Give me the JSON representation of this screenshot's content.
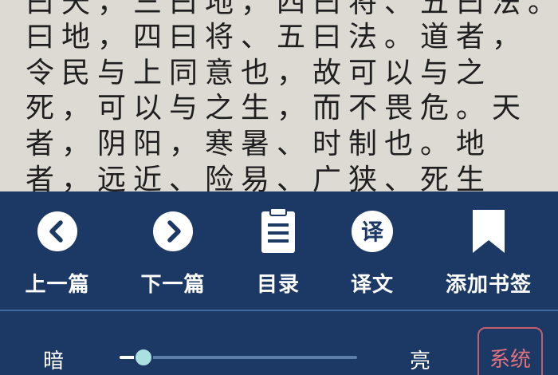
{
  "reader": {
    "lines": [
      "曰天，三曰地，四曰将、五曰法。",
      "曰地，四曰将、五曰法。道者，",
      "令民与上同意也，故可以与之",
      "死，可以与之生，而不畏危。天",
      "者，阴阳，寒暑、时制也。地",
      "者，远近、险易、广狭、死生"
    ]
  },
  "toolbar": {
    "items": [
      {
        "label": "上一篇",
        "icon": "chevron-left-circle-icon"
      },
      {
        "label": "下一篇",
        "icon": "chevron-right-circle-icon"
      },
      {
        "label": "目录",
        "icon": "document-list-icon"
      },
      {
        "label": "译文",
        "icon_text": "译",
        "label_text": "译文",
        "icon": "translate-icon"
      },
      {
        "label": "添加书签",
        "icon": "bookmark-icon"
      }
    ]
  },
  "brightness": {
    "dark_label": "暗",
    "bright_label": "亮",
    "level": 0.1,
    "system_label": "系统"
  },
  "colors": {
    "panel": "#1c3965",
    "text_on_panel": "#ffffff",
    "system_accent": "#e0727e",
    "page_bg": "#dcdad2"
  }
}
